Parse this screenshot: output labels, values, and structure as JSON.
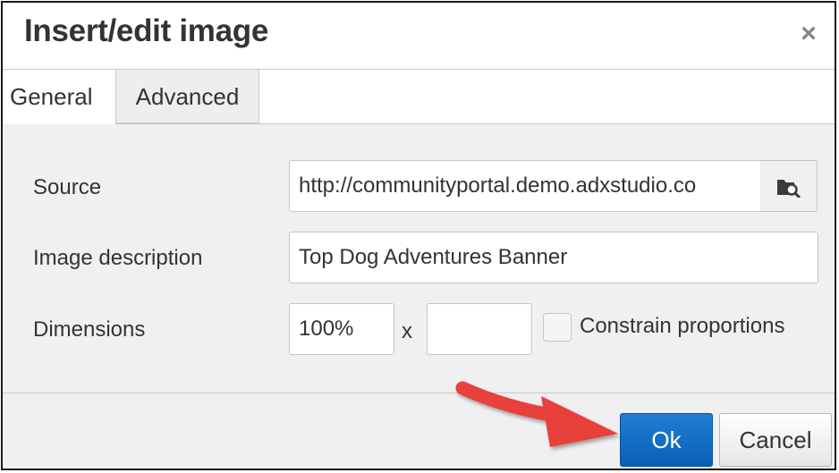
{
  "dialog": {
    "title": "Insert/edit image",
    "close_icon": "close-icon",
    "close_glyph": "×"
  },
  "tabs": [
    {
      "label": "General",
      "active": true
    },
    {
      "label": "Advanced",
      "active": false
    }
  ],
  "form": {
    "source": {
      "label": "Source",
      "value": "http://communityportal.demo.adxstudio.co",
      "browse_icon": "folder-search-icon"
    },
    "description": {
      "label": "Image description",
      "value": "Top Dog Adventures Banner"
    },
    "dimensions": {
      "label": "Dimensions",
      "width_value": "100%",
      "separator": "x",
      "height_value": "",
      "constrain_label": "Constrain proportions",
      "constrain_checked": false
    }
  },
  "footer": {
    "ok_label": "Ok",
    "cancel_label": "Cancel"
  },
  "annotation": {
    "type": "red arrow pointing at Ok button",
    "color": "#e8403a"
  },
  "colors": {
    "primary_button": "#0a5fb8",
    "panel_bg": "#f0f0f0"
  }
}
